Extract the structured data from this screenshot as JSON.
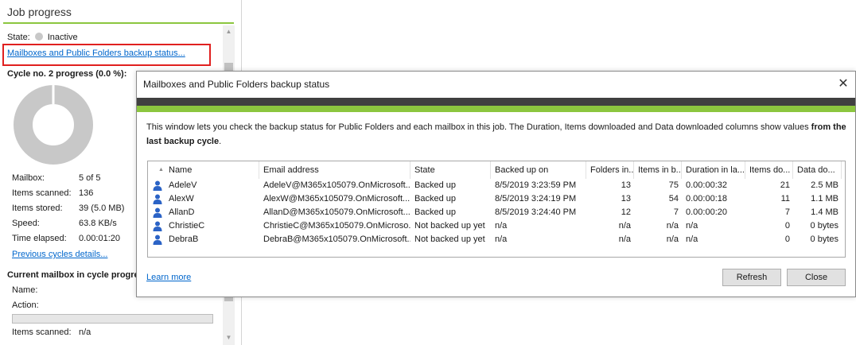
{
  "left_panel": {
    "title": "Job progress",
    "state_label": "State:",
    "state_value": "Inactive",
    "backup_status_link": "Mailboxes and Public Folders backup status...",
    "cycle_heading": "Cycle no. 2 progress (0.0 %):",
    "cycle_progress_percent": 0.0,
    "stats": [
      {
        "label": "Mailbox:",
        "value": "5 of 5"
      },
      {
        "label": "Items scanned:",
        "value": "136"
      },
      {
        "label": "Items stored:",
        "value": "39 (5.0 MB)"
      },
      {
        "label": "Speed:",
        "value": "63.8 KB/s"
      },
      {
        "label": "Time elapsed:",
        "value": "0.00:01:20"
      }
    ],
    "previous_cycles_link": "Previous cycles details...",
    "current_mailbox_heading": "Current mailbox in cycle progress",
    "name_label": "Name:",
    "action_label": "Action:",
    "items_scanned_label": "Items scanned:",
    "items_scanned_value": "n/a"
  },
  "dialog": {
    "title": "Mailboxes and Public Folders backup status",
    "description_plain": "This window lets you check the backup status for Public Folders and each mailbox in this job. The Duration, Items downloaded and Data downloaded columns show values ",
    "description_bold": "from the last backup cycle",
    "description_end": ".",
    "columns": [
      "Name",
      "Email address",
      "State",
      "Backed up on",
      "Folders in...",
      "Items in b...",
      "Duration in la...",
      "Items do...",
      "Data do..."
    ],
    "rows": [
      [
        "AdeleV",
        "AdeleV@M365x105079.OnMicrosoft....",
        "Backed up",
        "8/5/2019 3:23:59 PM",
        "13",
        "75",
        "0.00:00:32",
        "21",
        "2.5 MB"
      ],
      [
        "AlexW",
        "AlexW@M365x105079.OnMicrosoft....",
        "Backed up",
        "8/5/2019 3:24:19 PM",
        "13",
        "54",
        "0.00:00:18",
        "11",
        "1.1 MB"
      ],
      [
        "AllanD",
        "AllanD@M365x105079.OnMicrosoft....",
        "Backed up",
        "8/5/2019 3:24:40 PM",
        "12",
        "7",
        "0.00:00:20",
        "7",
        "1.4 MB"
      ],
      [
        "ChristieC",
        "ChristieC@M365x105079.OnMicroso...",
        "Not backed up yet",
        "n/a",
        "n/a",
        "n/a",
        "n/a",
        "0",
        "0 bytes"
      ],
      [
        "DebraB",
        "DebraB@M365x105079.OnMicrosoft....",
        "Not backed up yet",
        "n/a",
        "n/a",
        "n/a",
        "n/a",
        "0",
        "0 bytes"
      ]
    ],
    "learn_more": "Learn more",
    "refresh_label": "Refresh",
    "close_label": "Close"
  },
  "colors": {
    "accent_green": "#8cc63f",
    "band_dark": "#404040",
    "link_blue": "#0066cc",
    "highlight_red": "#e0201f",
    "donut_gray": "#c8c8c8",
    "user_icon_blue": "#2b63c6"
  }
}
